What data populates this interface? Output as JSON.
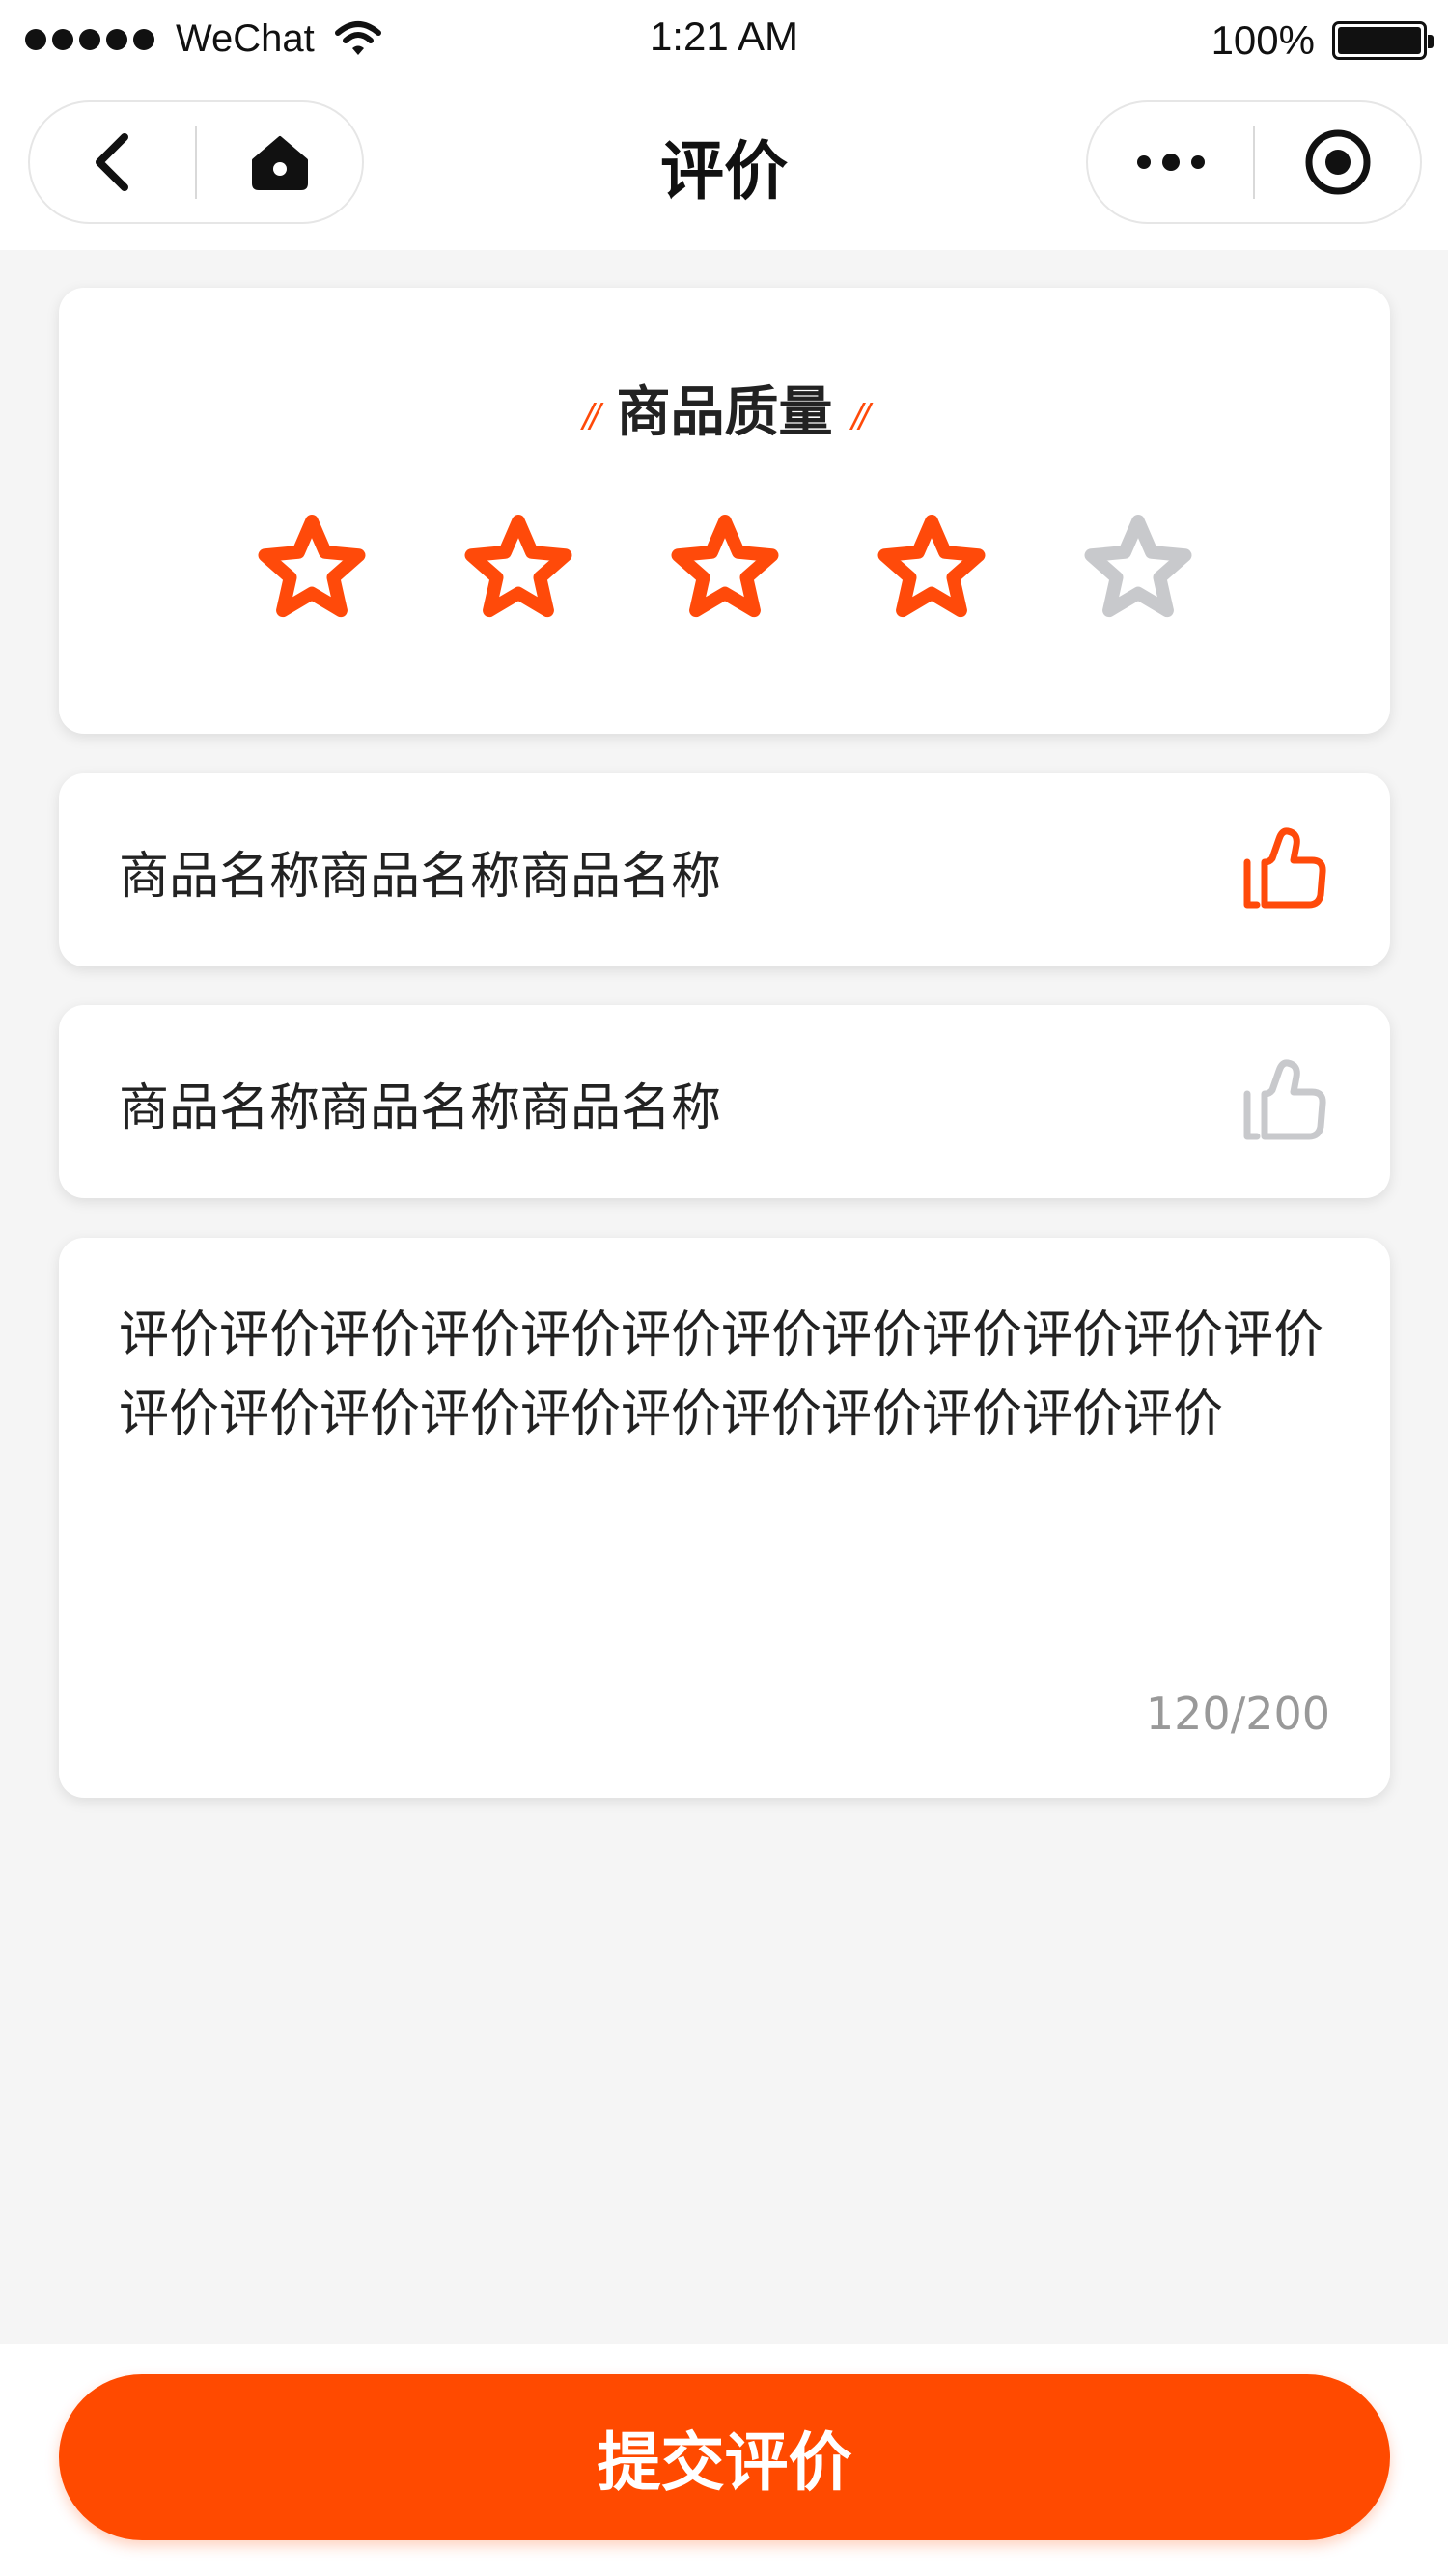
{
  "status_bar": {
    "carrier": "WeChat",
    "time": "1:21 AM",
    "battery": "100%"
  },
  "nav": {
    "title": "评价",
    "icons": [
      "back-chevron-icon",
      "home-icon",
      "more-dots-icon",
      "close-target-icon"
    ]
  },
  "rating": {
    "title": "商品质量",
    "title_decoration": "//",
    "stars_total": 5,
    "stars_selected": 4,
    "colors": {
      "active": "#ff4a0a",
      "inactive": "#c8c9cc"
    }
  },
  "products": [
    {
      "name": "商品名称商品名称商品名称",
      "liked": true,
      "icon": "thumbs-up-icon"
    },
    {
      "name": "商品名称商品名称商品名称",
      "liked": false,
      "icon": "thumbs-up-icon"
    }
  ],
  "review": {
    "text": "评价评价评价评价评价评价评价评价评价评价评价评价评价评价评价评价评价评价评价评价评价评价评价",
    "counter": "120/200"
  },
  "submit": {
    "label": "提交评价",
    "color": "#ff4a00"
  }
}
